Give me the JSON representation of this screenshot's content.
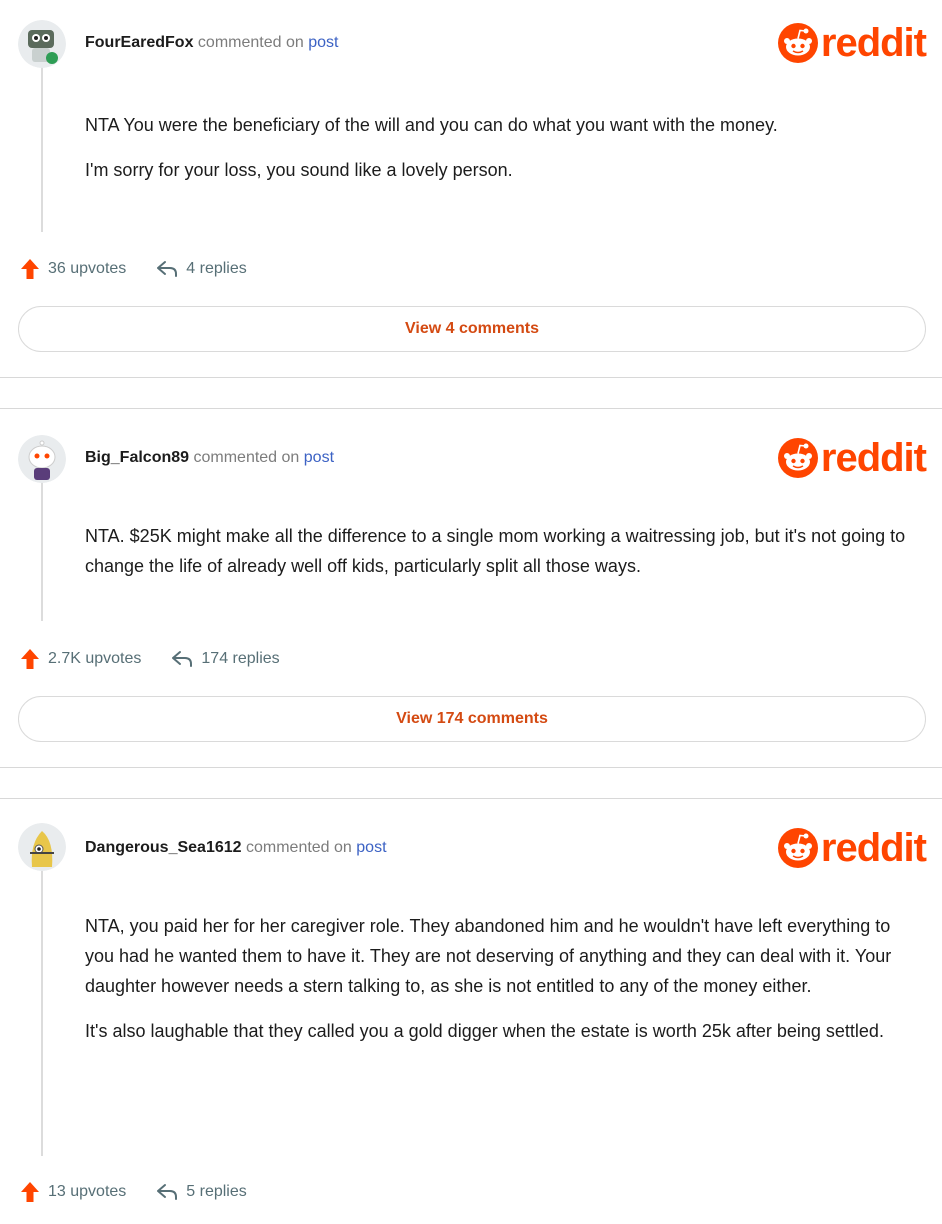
{
  "comments": [
    {
      "username": "FourEaredFox",
      "commented_on": "commented on",
      "post_link": "post",
      "logo_text": "reddit",
      "paragraphs": [
        "NTA You were the beneficiary of the will and you can do what you want with the money.",
        "I'm sorry for your loss, you sound like a lovely person."
      ],
      "upvotes": "36 upvotes",
      "replies": "4 replies",
      "view_button": "View 4 comments"
    },
    {
      "username": "Big_Falcon89",
      "commented_on": "commented on",
      "post_link": "post",
      "logo_text": "reddit",
      "paragraphs": [
        "NTA. $25K might make all the difference to a single mom working a waitressing job, but it's not going to change the life of already well off kids, particularly split all those ways."
      ],
      "upvotes": "2.7K upvotes",
      "replies": "174 replies",
      "view_button": "View 174 comments"
    },
    {
      "username": "Dangerous_Sea1612",
      "commented_on": "commented on",
      "post_link": "post",
      "logo_text": "reddit",
      "paragraphs": [
        "NTA, you paid her for her caregiver role. They abandoned him and he wouldn't have left everything to you had he wanted them to have it. They are not deserving of anything and they can deal with it. Your daughter however needs a stern talking to, as she is not entitled to any of the money either.",
        "It's also laughable that they called you a gold digger when the estate is worth 25k after being settled."
      ],
      "upvotes": "13 upvotes",
      "replies": "5 replies"
    }
  ],
  "colors": {
    "brand": "#ff4500",
    "link": "#3c62c4",
    "button_text": "#d44a12"
  },
  "icons": {
    "upvote": "upvote-arrow-icon",
    "reply": "reply-arrow-icon",
    "logo": "reddit-snoo-icon"
  }
}
